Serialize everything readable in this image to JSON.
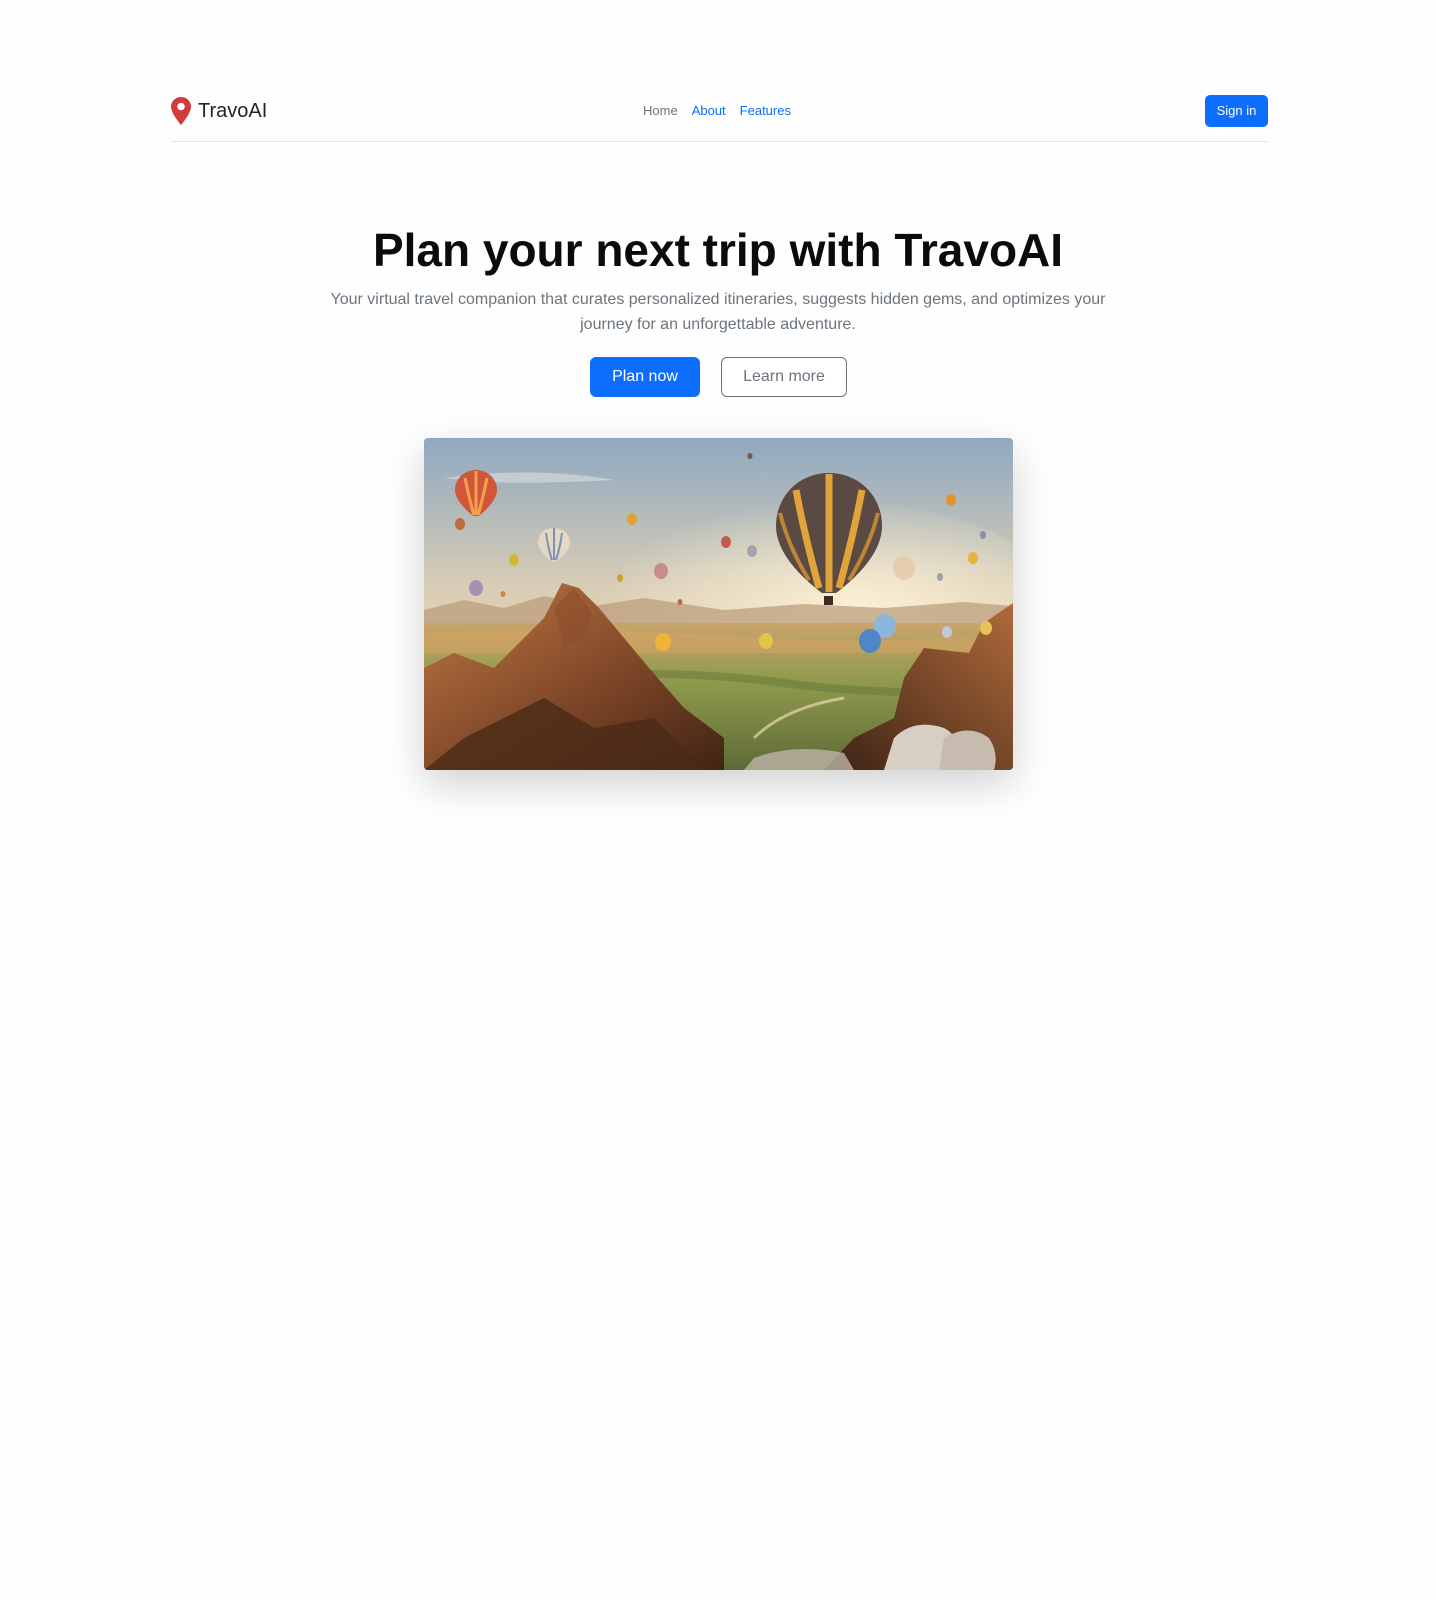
{
  "brand": {
    "name": "TravoAI",
    "icon": "map-pin-icon",
    "icon_color": "#d23b3b"
  },
  "nav": {
    "home": "Home",
    "about": "About",
    "features": "Features"
  },
  "header": {
    "signin_label": "Sign in"
  },
  "hero": {
    "title": "Plan your next trip with TravoAI",
    "subtitle": "Your virtual travel companion that curates personalized itineraries, suggests hidden gems, and optimizes your journey for an unforgettable adventure.",
    "primary_button": "Plan now",
    "secondary_button": "Learn more",
    "image_alt": "Hot air balloons over rocky valley at sunrise"
  },
  "colors": {
    "primary": "#0d6efd",
    "muted": "#6c757d",
    "heading": "#0b0b0b",
    "pin": "#d23b3b"
  }
}
